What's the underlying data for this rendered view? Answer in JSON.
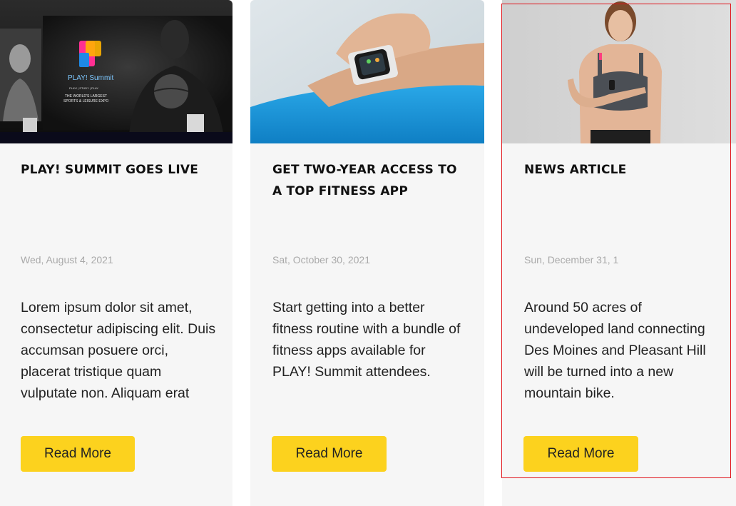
{
  "cards": [
    {
      "image": {
        "screen_logo": "PLAY! Summit",
        "screen_small": "PLAY! | STUDY | PLAY",
        "screen_tagline_1": "THE WORLD'S LARGEST",
        "screen_tagline_2": "SPORTS & LEISURE EXPO"
      },
      "title": "PLAY! SUMMIT GOES LIVE",
      "date": "Wed, August 4, 2021",
      "text": "Lorem ipsum dolor sit amet, consectetur adipiscing elit. Duis accumsan posuere orci, placerat tristique quam vulputate non. Aliquam erat",
      "button": "Read More"
    },
    {
      "title": "GET TWO-YEAR ACCESS TO A TOP FITNESS APP",
      "date": "Sat, October 30, 2021",
      "text": "Start getting into a better fitness routine with a bundle of fitness apps available for PLAY! Summit attendees.",
      "button": "Read More"
    },
    {
      "title": "NEWS ARTICLE",
      "date": "Sun, December 31, 1",
      "text": "Around 50 acres of undeveloped land connecting Des Moines and Pleasant Hill will be turned into a new mountain bike.",
      "button": "Read More"
    }
  ],
  "colors": {
    "button": "#fcd21e",
    "card_background": "#f6f6f6",
    "date_text": "#a9a9a9",
    "highlight": "#e0131a"
  }
}
